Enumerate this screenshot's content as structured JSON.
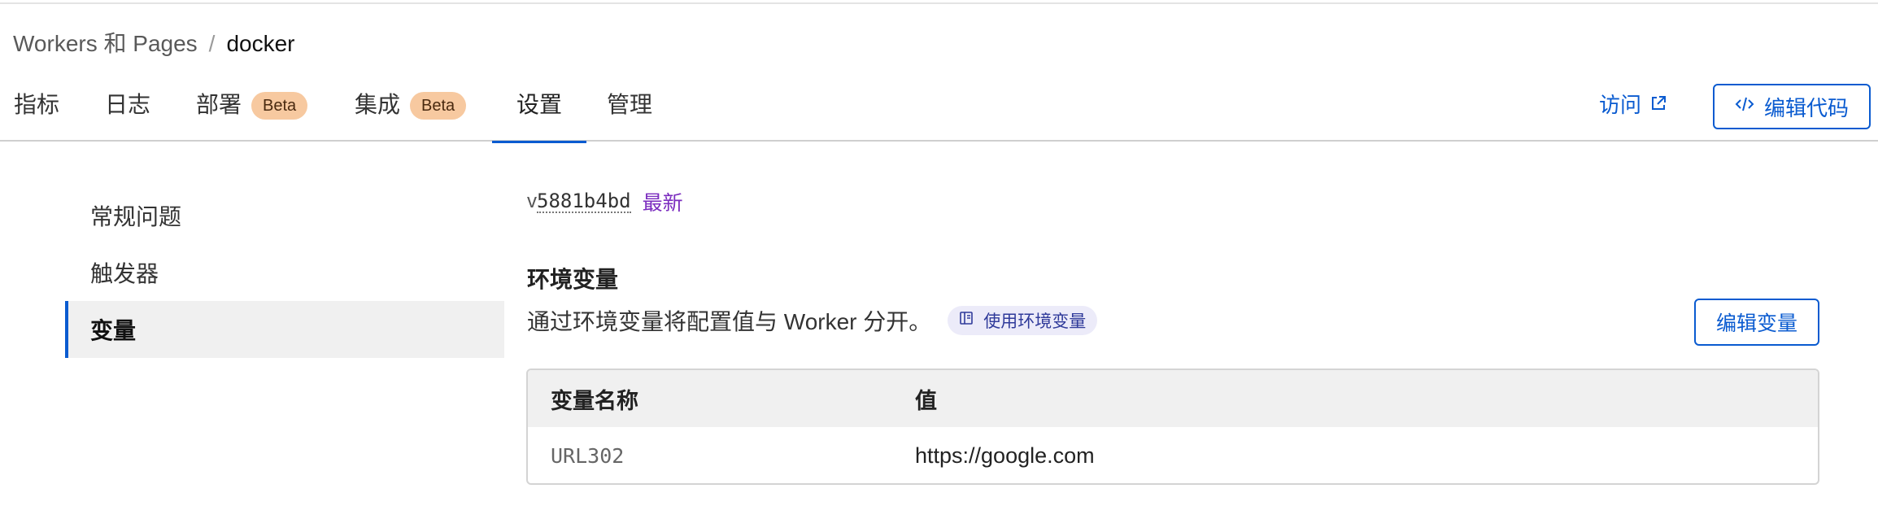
{
  "breadcrumb": {
    "parent": "Workers 和 Pages",
    "separator": "/",
    "current": "docker"
  },
  "tabs": [
    {
      "label": "指标",
      "badge": null
    },
    {
      "label": "日志",
      "badge": null
    },
    {
      "label": "部署",
      "badge": "Beta"
    },
    {
      "label": "集成",
      "badge": "Beta"
    },
    {
      "label": "设置",
      "badge": null,
      "active": true
    },
    {
      "label": "管理",
      "badge": null
    }
  ],
  "header_actions": {
    "visit_label": "访问",
    "visit_icon": "external-link-icon",
    "edit_code_label": "编辑代码",
    "edit_code_icon": "code-icon"
  },
  "sidebar": {
    "items": [
      {
        "label": "常规问题"
      },
      {
        "label": "触发器"
      },
      {
        "label": "变量",
        "active": true
      }
    ]
  },
  "version": {
    "prefix": "v",
    "hash": "5881b4bd",
    "tag": "最新"
  },
  "env_vars": {
    "title": "环境变量",
    "description": "通过环境变量将配置值与 Worker 分开。",
    "doc_link_label": "使用环境变量",
    "doc_link_icon": "book-icon",
    "edit_button_label": "编辑变量",
    "columns": [
      "变量名称",
      "值"
    ],
    "rows": [
      {
        "name": "URL302",
        "value": "https://google.com"
      }
    ]
  },
  "colors": {
    "accent": "#0a5bd0",
    "badge_bg": "#f7c9a0",
    "latest_tag": "#7b2cbf"
  }
}
